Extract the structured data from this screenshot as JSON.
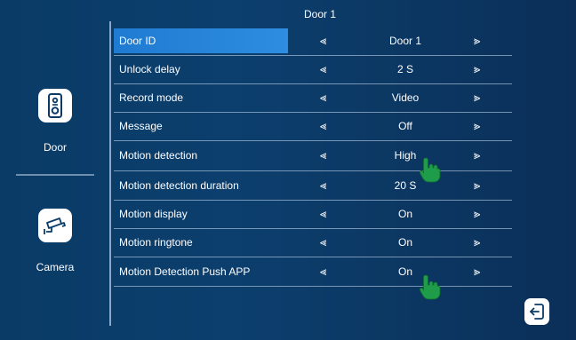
{
  "header": {
    "title": "Door 1"
  },
  "sidebar": {
    "items": [
      {
        "label": "Door",
        "icon": "doorbell-icon",
        "selected": true
      },
      {
        "label": "Camera",
        "icon": "camera-icon",
        "selected": false
      }
    ]
  },
  "settings": {
    "rows": [
      {
        "label": "Door ID",
        "value": "Door 1"
      },
      {
        "label": "Unlock delay",
        "value": "2 S"
      },
      {
        "label": "Record mode",
        "value": "Video"
      },
      {
        "label": "Message",
        "value": "Off"
      },
      {
        "label": "Motion detection",
        "value": "High"
      },
      {
        "label": "Motion detection duration",
        "value": "20 S"
      },
      {
        "label": "Motion display",
        "value": "On"
      },
      {
        "label": "Motion ringtone",
        "value": "On"
      },
      {
        "label": "Motion Detection Push APP",
        "value": "On"
      }
    ],
    "arrow_left_glyph": "⪡",
    "arrow_right_glyph": "⪢",
    "selected_row_index": 0
  },
  "exit": {
    "icon": "exit-icon"
  },
  "colors": {
    "background": "#0b3a66",
    "highlight": "#2585d8",
    "hand_cursor": "#1f9c4a",
    "text": "#ffffff"
  }
}
